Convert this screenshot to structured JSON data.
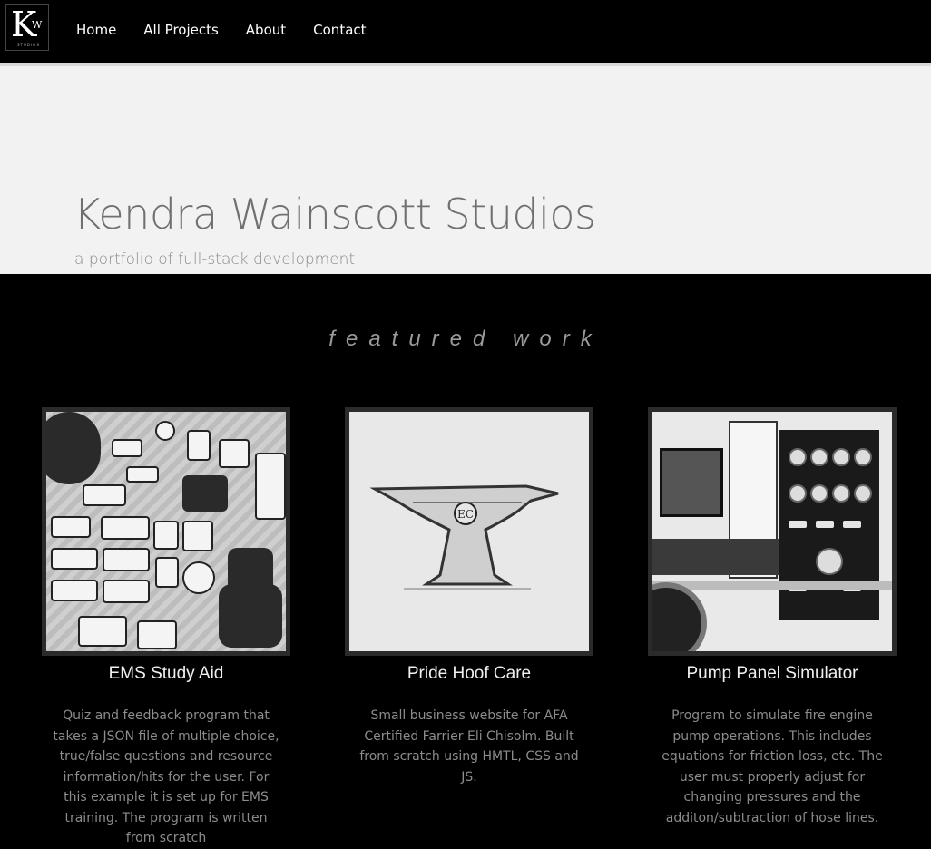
{
  "nav": {
    "logo": {
      "letter_main": "K",
      "letter_small": "W",
      "tagline": "STUDIOS"
    },
    "links": [
      {
        "label": "Home"
      },
      {
        "label": "All Projects"
      },
      {
        "label": "About"
      },
      {
        "label": "Contact"
      }
    ]
  },
  "hero": {
    "title": "Kendra Wainscott Studios",
    "subtitle": "a portfolio of full-stack development"
  },
  "featured": {
    "heading": "featured work",
    "projects": [
      {
        "title": "EMS Study Aid",
        "description": "Quiz and feedback program that takes a JSON file of multiple choice, true/false questions and resource information/hits for the user. For this example it is set up for EMS training. The program is written from scratch"
      },
      {
        "title": "Pride Hoof Care",
        "description": "Small business website for AFA Certified Farrier Eli Chisolm. Built from scratch using HMTL, CSS and JS."
      },
      {
        "title": "Pump Panel Simulator",
        "description": "Program to simulate fire engine pump operations. This includes equations for friction loss, etc. The user must properly adjust for changing pressures and the additon/subtraction of hose lines."
      }
    ]
  },
  "colors": {
    "nav_bg": "#000000",
    "hero_bg": "#f2f2f2",
    "page_bg": "#000000",
    "heading_text": "#9a9a9a"
  }
}
